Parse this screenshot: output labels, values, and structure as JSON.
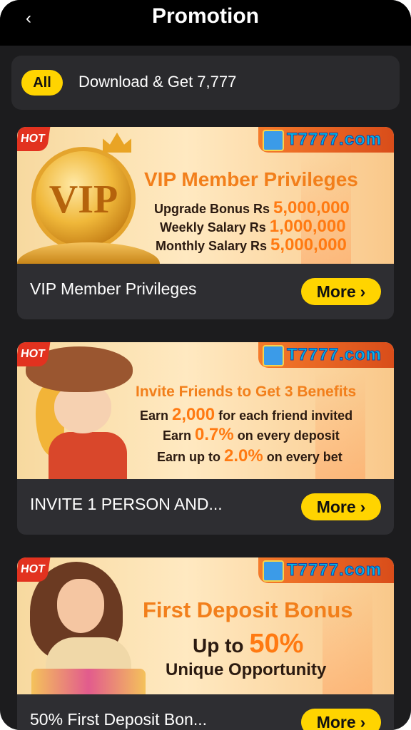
{
  "header": {
    "back_icon": "chevron-left-icon",
    "title": "Promotion"
  },
  "filters": {
    "all_label": "All",
    "item_label": "Download & Get 7,777"
  },
  "promotions": [
    {
      "hot": "HOT",
      "brand": "T7777.com",
      "banner": {
        "heading": "VIP Member Privileges",
        "line1_pre": "Upgrade Bonus Rs ",
        "line1_value": "5,000,000",
        "line2_pre": "Weekly Salary Rs ",
        "line2_value": "1,000,000",
        "line3_pre": "Monthly Salary Rs ",
        "line3_value": "5,000,000",
        "art_text": "VIP"
      },
      "title": "VIP Member Privileges",
      "more_label": "More"
    },
    {
      "hot": "HOT",
      "brand": "T7777.com",
      "banner": {
        "heading": "Invite Friends to Get 3 Benefits",
        "line1_pre": "Earn ",
        "line1_value": "2,000",
        "line1_post": " for each friend invited",
        "line2_pre": "Earn ",
        "line2_value": "0.7%",
        "line2_post": " on every deposit",
        "line3_pre": "Earn up to ",
        "line3_value": "2.0%",
        "line3_post": " on every bet"
      },
      "title": "INVITE 1 PERSON AND...",
      "more_label": "More"
    },
    {
      "hot": "HOT",
      "brand": "T7777.com",
      "banner": {
        "heading": "First Deposit Bonus",
        "line1_pre": "Up to ",
        "line1_value": "50%",
        "line2": "Unique Opportunity"
      },
      "title": "50% First Deposit Bon...",
      "more_label": "More"
    }
  ],
  "colors": {
    "accent": "#ffd400",
    "background": "#1c1c1e",
    "card": "#2e2e32",
    "banner_orange": "#f27f1b"
  }
}
